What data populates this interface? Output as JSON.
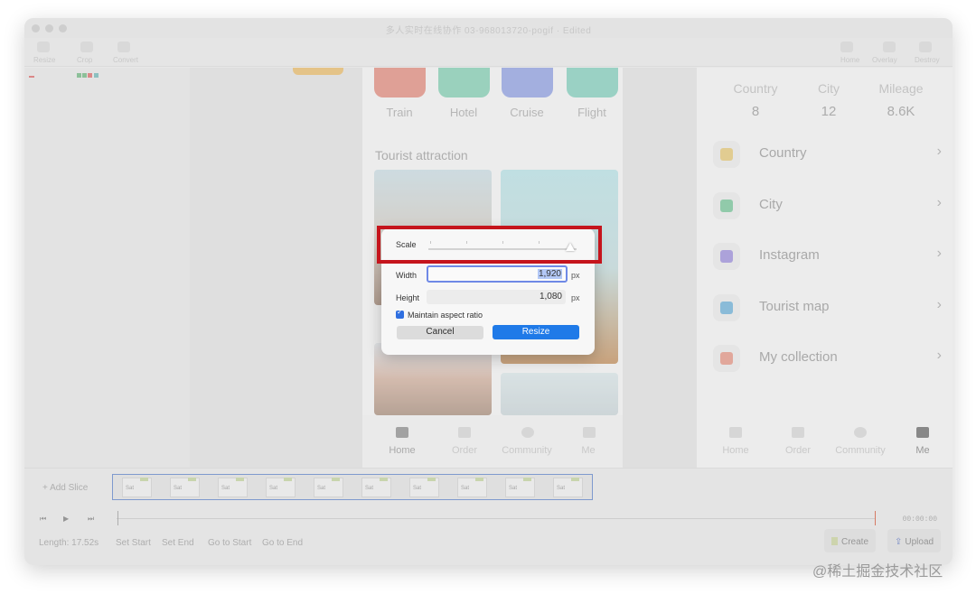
{
  "window": {
    "title": "多人实时在线协作 03-968013720-pogif",
    "title_suffix": "· Edited"
  },
  "toolbar": {
    "left": [
      "Resize",
      "Crop",
      "Convert"
    ],
    "right": [
      "Home",
      "Overlay",
      "Destroy"
    ]
  },
  "phone": {
    "categories": [
      {
        "label": "Train",
        "color": "#e07a6a"
      },
      {
        "label": "Hotel",
        "color": "#6fc9a8"
      },
      {
        "label": "Cruise",
        "color": "#7e92e0"
      },
      {
        "label": "Flight",
        "color": "#6fc9b4"
      }
    ],
    "section_title": "Tourist attraction",
    "nav": [
      "Home",
      "Order",
      "Community",
      "Me"
    ]
  },
  "right_phone": {
    "stats": [
      {
        "label": "Country",
        "value": "8"
      },
      {
        "label": "City",
        "value": "12"
      },
      {
        "label": "Mileage",
        "value": "8.6K"
      }
    ],
    "menu": [
      {
        "label": "Country",
        "icon": "flag-icon",
        "color": "#e6c25a"
      },
      {
        "label": "City",
        "icon": "city-icon",
        "color": "#5bbd86"
      },
      {
        "label": "Instagram",
        "icon": "camera-icon",
        "color": "#8a78d8"
      },
      {
        "label": "Tourist map",
        "icon": "map-pin-icon",
        "color": "#4fa4d6"
      },
      {
        "label": "My collection",
        "icon": "star-icon",
        "color": "#e5806c"
      }
    ],
    "nav": [
      "Home",
      "Order",
      "Community",
      "Me"
    ]
  },
  "dialog": {
    "scale_label": "Scale",
    "scale_fraction": 0.96,
    "width_label": "Width",
    "width_value": "1,920",
    "height_label": "Height",
    "height_value": "1,080",
    "unit": "px",
    "maintain_label": "Maintain aspect ratio",
    "maintain_checked": true,
    "cancel_label": "Cancel",
    "resize_label": "Resize",
    "highlight_color": "#c5141c"
  },
  "bottom": {
    "add_slice": "+ Add Slice",
    "frame_count": 10,
    "frame_tag": "Sat",
    "timecode": "00:00:00",
    "length": "Length: 17.52s",
    "links": [
      "Set Start",
      "Set End",
      "Go to Start",
      "Go to End"
    ],
    "create_label": "Create",
    "upload_label": "Upload"
  },
  "watermark": "@稀土掘金技术社区"
}
